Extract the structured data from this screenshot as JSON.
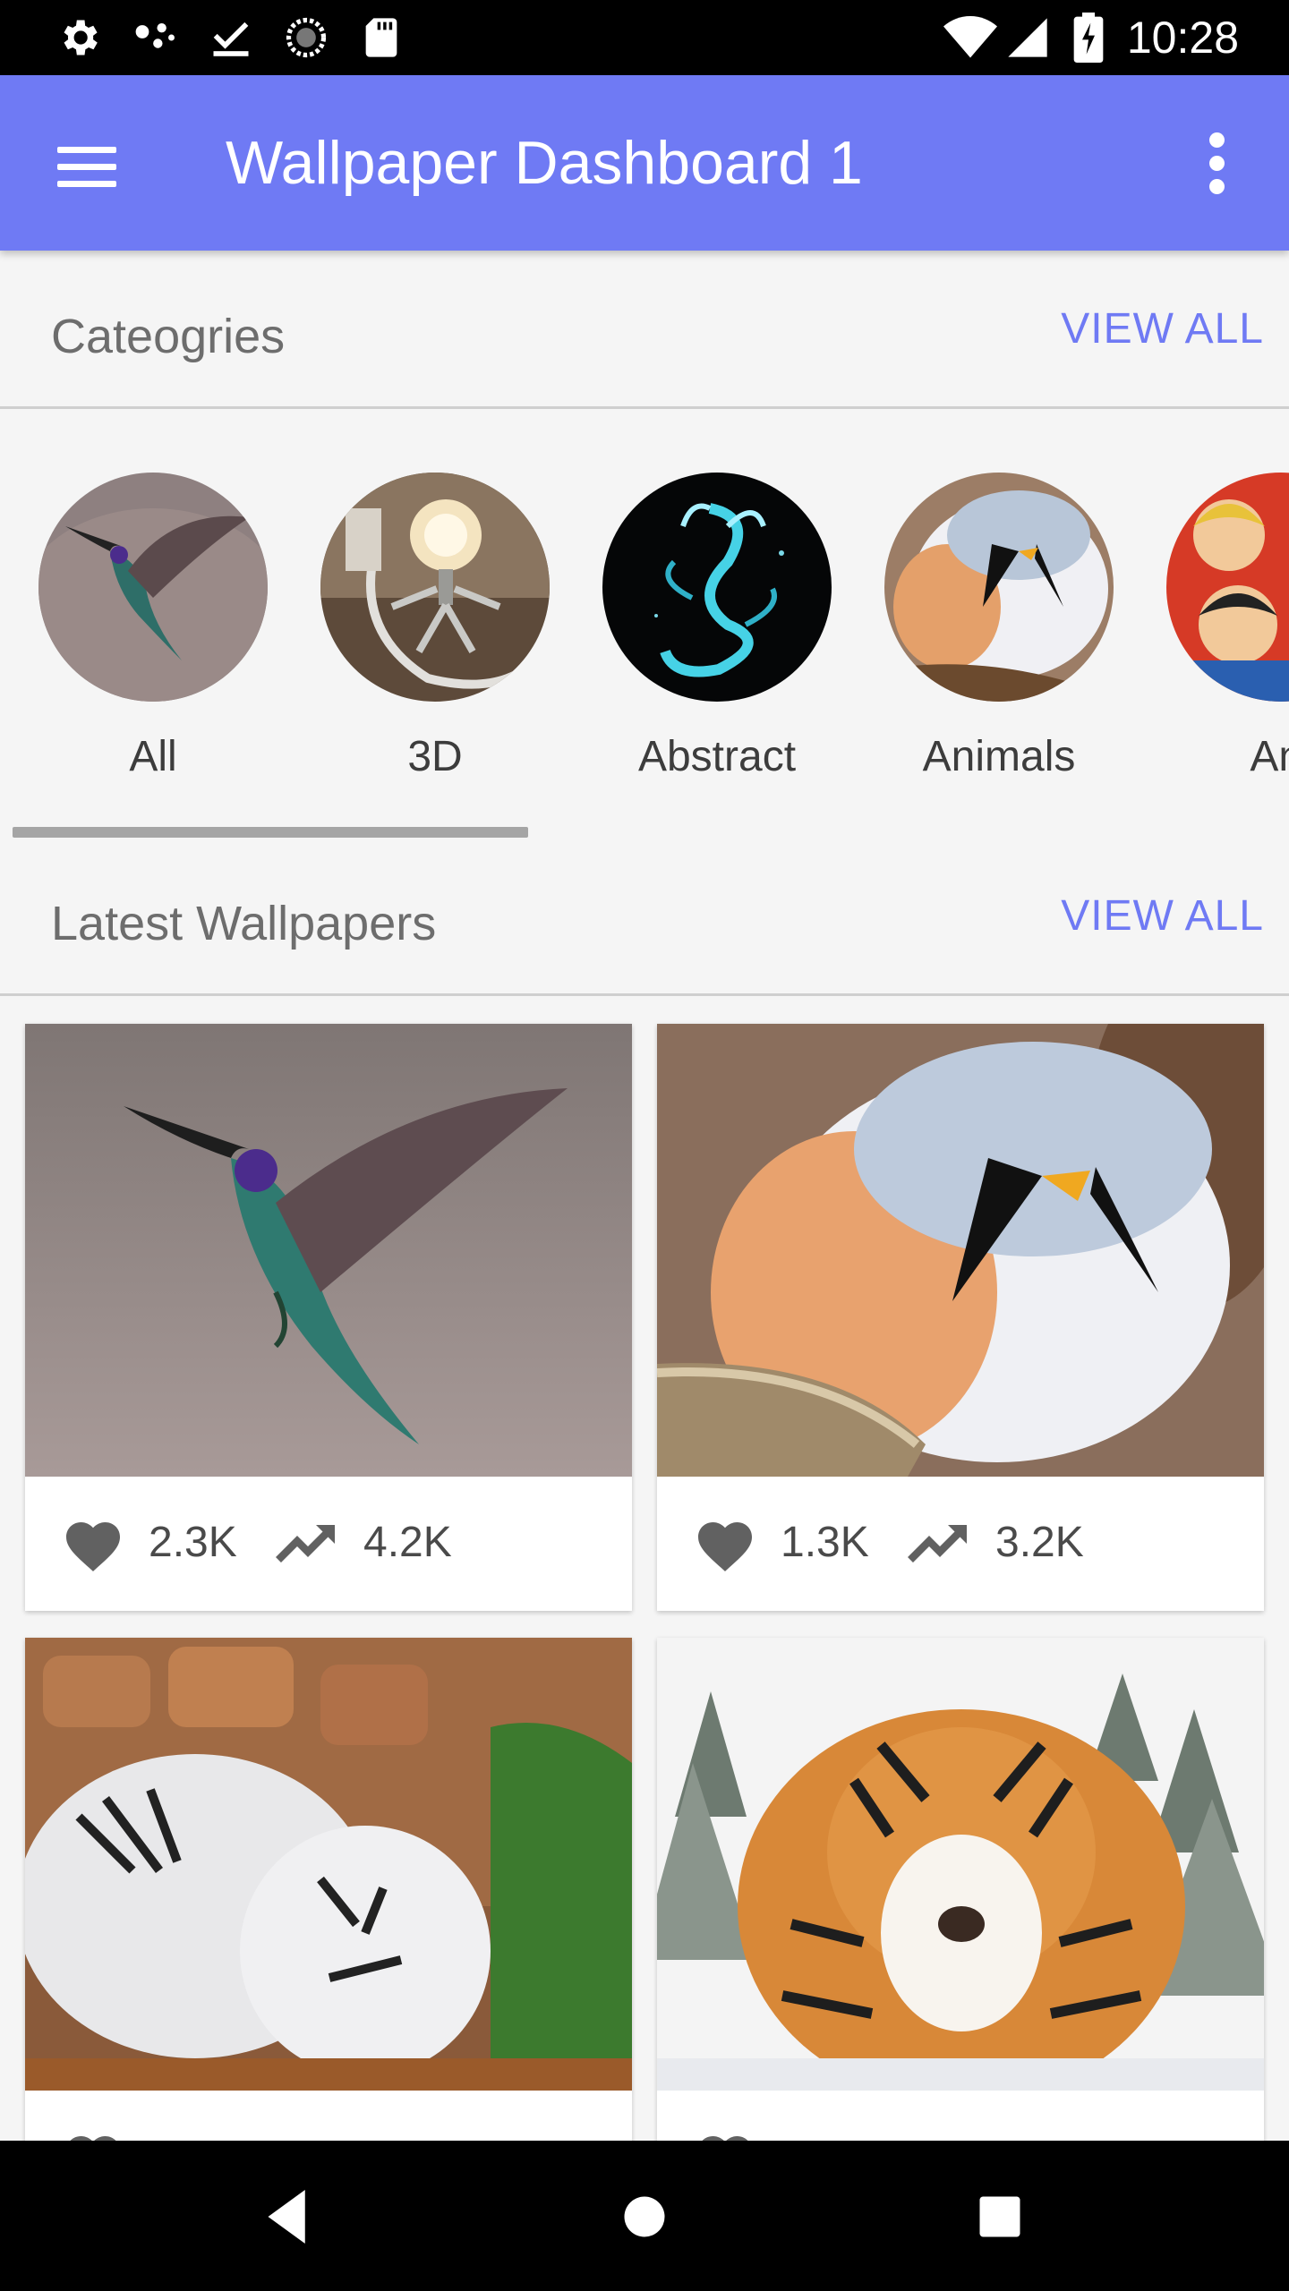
{
  "status_bar": {
    "time": "10:28"
  },
  "app_bar": {
    "title": "Wallpaper Dashboard 1"
  },
  "categories_section": {
    "title": "Cateogries",
    "view_all": "VIEW ALL",
    "items": [
      {
        "label": "All",
        "icon": "hummingbird"
      },
      {
        "label": "3D",
        "icon": "lamp-robot"
      },
      {
        "label": "Abstract",
        "icon": "neon-dragon"
      },
      {
        "label": "Animals",
        "icon": "round-bird"
      },
      {
        "label": "Ani",
        "icon": "anime-characters"
      }
    ]
  },
  "latest_section": {
    "title": "Latest Wallpapers",
    "view_all": "VIEW ALL",
    "wallpapers": [
      {
        "image": "hummingbird",
        "likes": "2.3K",
        "views": "4.2K"
      },
      {
        "image": "round-bird",
        "likes": "1.3K",
        "views": "3.2K"
      },
      {
        "image": "white-tigers",
        "likes": "",
        "views": ""
      },
      {
        "image": "tiger-in-snow",
        "likes": "",
        "views": ""
      }
    ]
  },
  "colors": {
    "accent": "#6f7af4",
    "background": "#f5f5f5"
  }
}
